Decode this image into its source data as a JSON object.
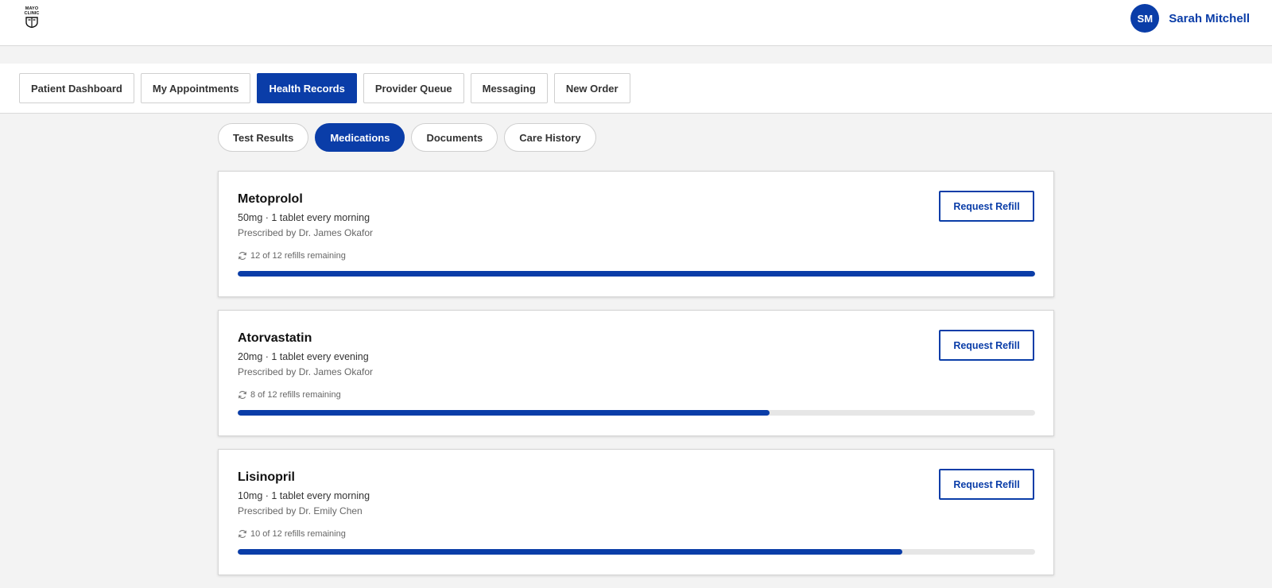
{
  "header": {
    "logo_lines": [
      "MAYO",
      "CLINIC"
    ],
    "user": {
      "initials": "SM",
      "name": "Sarah Mitchell"
    }
  },
  "nav": {
    "items": [
      {
        "label": "Patient Dashboard",
        "active": false
      },
      {
        "label": "My Appointments",
        "active": false
      },
      {
        "label": "Health Records",
        "active": true
      },
      {
        "label": "Provider Queue",
        "active": false
      },
      {
        "label": "Messaging",
        "active": false
      },
      {
        "label": "New Order",
        "active": false
      }
    ]
  },
  "subtabs": {
    "items": [
      {
        "label": "Test Results",
        "active": false
      },
      {
        "label": "Medications",
        "active": true
      },
      {
        "label": "Documents",
        "active": false
      },
      {
        "label": "Care History",
        "active": false
      }
    ]
  },
  "medications": [
    {
      "name": "Metoprolol",
      "dose": "50mg · 1 tablet every morning",
      "prescriber": "Prescribed by Dr. James Okafor",
      "refills_text": "12 of 12 refills remaining",
      "refills_remaining": 12,
      "refills_total": 12,
      "button": "Request Refill"
    },
    {
      "name": "Atorvastatin",
      "dose": "20mg · 1 tablet every evening",
      "prescriber": "Prescribed by Dr. James Okafor",
      "refills_text": "8 of 12 refills remaining",
      "refills_remaining": 8,
      "refills_total": 12,
      "button": "Request Refill"
    },
    {
      "name": "Lisinopril",
      "dose": "10mg · 1 tablet every morning",
      "prescriber": "Prescribed by Dr. Emily Chen",
      "refills_text": "10 of 12 refills remaining",
      "refills_remaining": 10,
      "refills_total": 12,
      "button": "Request Refill"
    }
  ],
  "colors": {
    "accent": "#0a3da8",
    "background": "#f3f3f3"
  },
  "icons": {
    "refill": "refresh-icon",
    "logo": "mayo-shield-icon"
  }
}
